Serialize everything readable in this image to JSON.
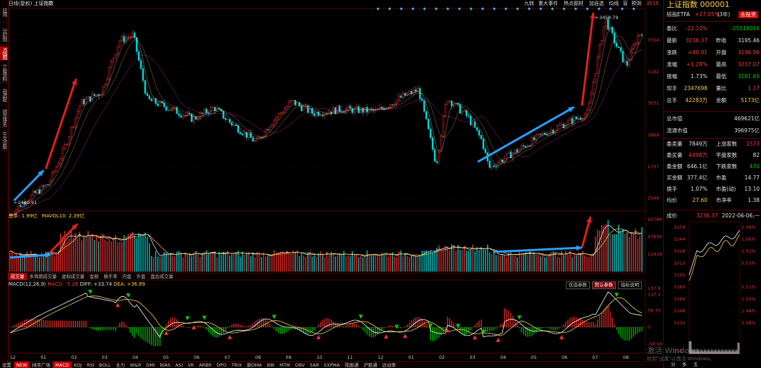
{
  "left_tabs": [
    {
      "label": "应用",
      "active": false
    },
    {
      "label": "分时图",
      "active": false
    },
    {
      "label": "K线图",
      "active": true
    },
    {
      "label": "个股资料",
      "active": false
    },
    {
      "label": "自选股",
      "active": false
    },
    {
      "label": "综合排名",
      "active": false
    },
    {
      "label": "牛叉诊股",
      "active": false
    }
  ],
  "topbar": {
    "period": "日线(复权)",
    "name": "上证指数",
    "menu": [
      "九转",
      "重大事件",
      "热点题材",
      "加自选",
      "均线",
      "盲",
      "预测"
    ],
    "price_tag": "3515"
  },
  "kline": {
    "high_label": "←3458.79",
    "low_label": "←2440.91",
    "yticks": [
      "3354",
      "3192",
      "3031",
      "2869",
      "2707",
      "2546"
    ]
  },
  "volume": {
    "legend": "总手: 1.99亿",
    "mavol": "MAVOL10: 2.39亿",
    "yticks": [
      "65784",
      "43856",
      "21928"
    ],
    "tabs": [
      "成交量",
      "多周期成交量",
      "虚拟成交量",
      "金额",
      "换手率",
      "内盘",
      "外盘",
      "盘后成交量"
    ]
  },
  "macd": {
    "legend": "MACD(12,26,9)",
    "macd": "MACD: -5.26",
    "diff": "DIFF: +33.74",
    "dea": "DEA: +36.89",
    "buttons": [
      "优选参数",
      "默认参数",
      "指标说明"
    ],
    "yticks": [
      "137.9",
      "117.1",
      "58.75",
      "0",
      "-59.56"
    ]
  },
  "xdates": [
    "12",
    "01",
    "02",
    "03",
    "04",
    "05",
    "06",
    "07",
    "08",
    "09",
    "10",
    "11",
    "12",
    "01",
    "02",
    "03",
    "04",
    "05",
    "06",
    "07",
    "08"
  ],
  "bottom_tabs": [
    "设置",
    "NEW",
    "排序广场",
    "MACD",
    "KDJ",
    "RSI",
    "BOLL",
    "主力",
    "W&R",
    "DMI",
    "BIAS",
    "ASI",
    "VR",
    "ARBR",
    "DPO",
    "TRIX",
    "新DMA",
    "BBI",
    "MTM",
    "OBV",
    "SAR",
    "EXPMA",
    "陆股通",
    "沪股通",
    "达动率"
  ],
  "right": {
    "title": "上证指数 000001",
    "etf": "综指ETFA",
    "etf_chg": "+27.05%",
    "etf_note": "(3年)",
    "etf_btn": "去投资",
    "stats": [
      {
        "l": "委比",
        "v": "-22.10%",
        "c": "red",
        "l2": "",
        "v2": "-25518016",
        "c2": "green"
      },
      {
        "l": "最新",
        "v": "3236.37",
        "c": "red",
        "l2": "昨收",
        "v2": "3195.46",
        "c2": "white"
      },
      {
        "l": "涨跌",
        "v": "+40.91",
        "c": "red",
        "l2": "开盘",
        "v2": "3196.96",
        "c2": "red"
      },
      {
        "l": "涨幅",
        "v": "+1.28%",
        "c": "red",
        "l2": "最高",
        "v2": "3237.07",
        "c2": "red"
      },
      {
        "l": "振幅",
        "v": "1.73%",
        "c": "white",
        "l2": "最低",
        "v2": "3181.65",
        "c2": "green"
      },
      {
        "l": "现手",
        "v": "2347698",
        "c": "yel",
        "l2": "量比",
        "v2": "1.17",
        "c2": "red"
      },
      {
        "l": "总手",
        "v": "42283万",
        "c": "yel",
        "l2": "金额",
        "v2": "5173亿",
        "c2": "yel"
      }
    ],
    "stats2": [
      {
        "l": "总市值",
        "v": "469621亿",
        "c": "white"
      },
      {
        "l": "流通市值",
        "v": "396975亿",
        "c": "white"
      }
    ],
    "stats3": [
      {
        "l": "委卖量",
        "v": "7849万",
        "c": "white",
        "l2": "上涨家数",
        "v2": "1573",
        "c2": "red"
      },
      {
        "l": "委买量",
        "v": "4498万",
        "c": "red",
        "l2": "平盘家数",
        "v2": "82",
        "c2": "white"
      },
      {
        "l": "委金额",
        "v": "646.1亿",
        "c": "white",
        "l2": "下跌家数",
        "v2": "470",
        "c2": "green"
      },
      {
        "l": "买金额",
        "v": "377.4亿",
        "c": "white",
        "l2": "市盈",
        "v2": "14.77",
        "c2": "white"
      },
      {
        "l": "换手",
        "v": "1.07%",
        "c": "white",
        "l2": "市盈(动)",
        "v2": "13.10",
        "c2": "white"
      },
      {
        "l": "均价",
        "v": "27.60",
        "c": "yel",
        "l2": "市净率",
        "v2": "1.38",
        "c2": "white"
      }
    ],
    "mini_head": {
      "l": "成价",
      "price": "3236.37",
      "date": "2022-06-06,一"
    },
    "mini_left": [
      "3259",
      "3244",
      "3228",
      "3212",
      "3195",
      "3180",
      "3164",
      "3148",
      "3132",
      "516"
    ],
    "mini_right": [
      "2.08%",
      "1.56%",
      "1.02%",
      "0.51%",
      "",
      "0.51%",
      "1.03%",
      "1.48%",
      "2.08%"
    ],
    "mini_bottom": [
      "分",
      "多",
      "五"
    ]
  },
  "watermark": "激活 Windows",
  "watermark2": "转到\"设置\"以激活 Windows。"
}
